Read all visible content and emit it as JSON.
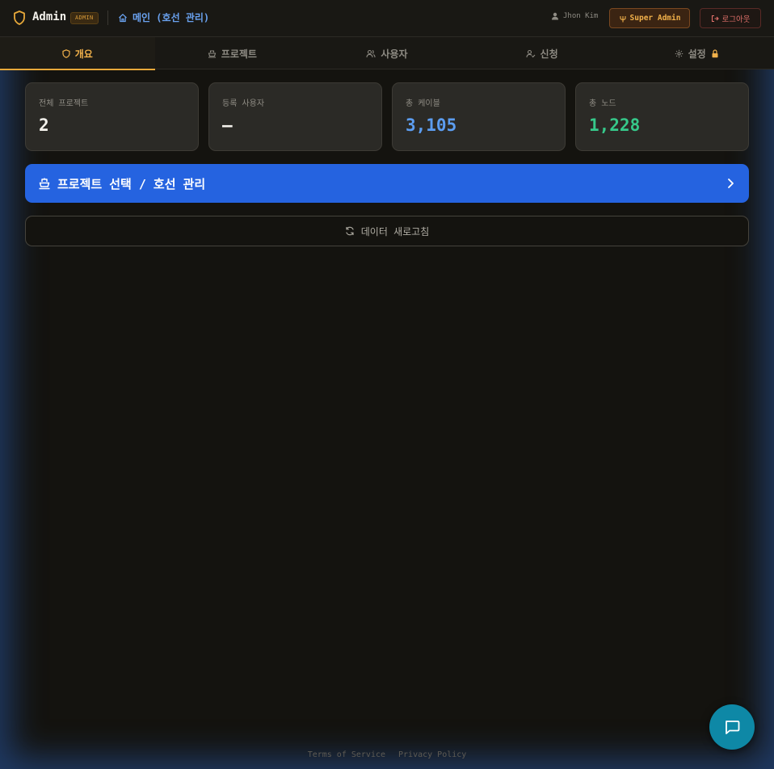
{
  "header": {
    "brand_title": "Admin",
    "brand_badge": "ADMIN",
    "home_link": "메인 (호선 관리)",
    "user_name": "Jhon Kim",
    "role_button": "Super Admin",
    "logout_button": "로그아웃"
  },
  "tabs": [
    {
      "label": "개요",
      "icon": "shield-icon",
      "active": true
    },
    {
      "label": "프로젝트",
      "icon": "ship-icon",
      "active": false
    },
    {
      "label": "사용자",
      "icon": "users-icon",
      "active": false
    },
    {
      "label": "신청",
      "icon": "user-check-icon",
      "active": false
    },
    {
      "label": "설정",
      "icon": "gear-icon",
      "active": false,
      "locked": true
    }
  ],
  "stats": [
    {
      "label": "전체 프로젝트",
      "value": "2",
      "color": "#f4f2ec"
    },
    {
      "label": "등록 사용자",
      "value": "—",
      "color": "#f4f2ec"
    },
    {
      "label": "총 케이블",
      "value": "3,105",
      "color": "#5c9df0"
    },
    {
      "label": "총 노드",
      "value": "1,228",
      "color": "#36c88a"
    }
  ],
  "project_button": {
    "label": "프로젝트 선택 / 호선 관리"
  },
  "refresh_button": {
    "label": "데이터 새로고침"
  },
  "footer": {
    "terms": "Terms of Service",
    "privacy": "Privacy Policy"
  },
  "colors": {
    "accent": "#e8a93a",
    "primary": "#2563e0",
    "chat": "#0e88a6"
  }
}
